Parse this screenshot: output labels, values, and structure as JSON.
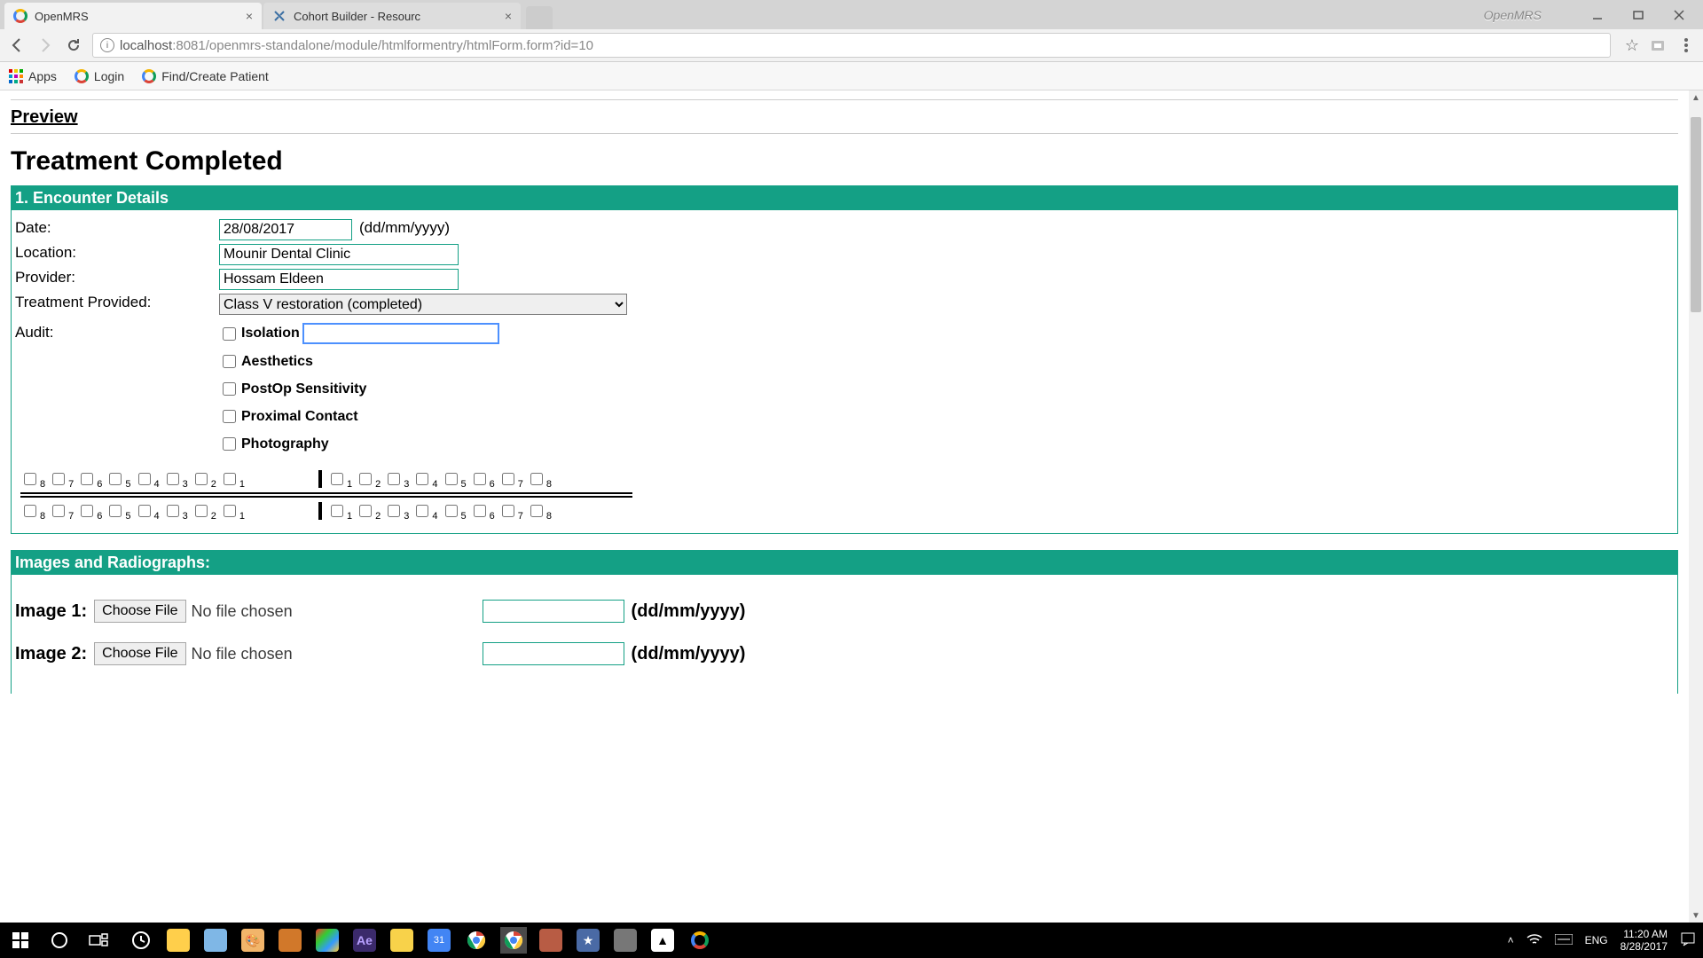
{
  "chrome": {
    "tabs": [
      {
        "title": "OpenMRS",
        "active": true
      },
      {
        "title": "Cohort Builder - Resourc",
        "active": false
      }
    ],
    "brand_watermark": "OpenMRS",
    "url_host": "localhost",
    "url_port_path": ":8081/openmrs-standalone/module/htmlformentry/htmlForm.form?id=10",
    "bookmarks": {
      "apps": "Apps",
      "login": "Login",
      "find": "Find/Create Patient"
    }
  },
  "page": {
    "preview": "Preview",
    "form_title": "Treatment Completed",
    "section1_title": "1. Encounter Details",
    "labels": {
      "date": "Date:",
      "date_hint": "(dd/mm/yyyy)",
      "location": "Location:",
      "provider": "Provider:",
      "treatment": "Treatment Provided:",
      "audit": "Audit:"
    },
    "values": {
      "date": "28/08/2017",
      "location": "Mounir Dental Clinic",
      "provider": "Hossam Eldeen",
      "treatment_selected": "Class V restoration (completed)"
    },
    "audit_items": [
      "Isolation",
      "Aesthetics",
      "PostOp Sensitivity",
      "Proximal Contact",
      "Photography"
    ],
    "tooth_numbers_desc": [
      "8",
      "7",
      "6",
      "5",
      "4",
      "3",
      "2",
      "1"
    ],
    "tooth_numbers_asc": [
      "1",
      "2",
      "3",
      "4",
      "5",
      "6",
      "7",
      "8"
    ],
    "section2_title": "Images and Radiographs:",
    "images": {
      "label1": "Image 1:",
      "label2": "Image 2:",
      "choose": "Choose File",
      "nofile": "No file chosen",
      "date_hint": "(dd/mm/yyyy)"
    }
  },
  "taskbar": {
    "lang": "ENG",
    "time": "11:20 AM",
    "date": "8/28/2017"
  }
}
